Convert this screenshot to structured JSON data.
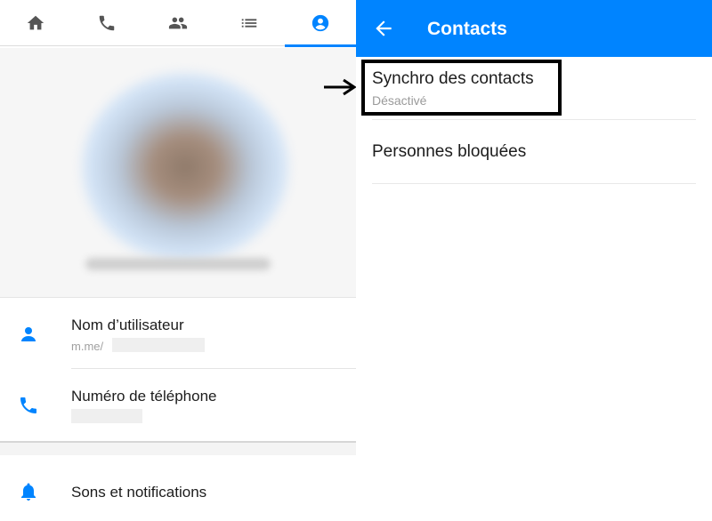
{
  "left_panel": {
    "tabs": [
      {
        "icon": "home-icon"
      },
      {
        "icon": "phone-icon"
      },
      {
        "icon": "people-icon"
      },
      {
        "icon": "list-icon"
      },
      {
        "icon": "account-icon",
        "active": true
      }
    ],
    "rows": {
      "username": {
        "title": "Nom d’utilisateur",
        "prefix": "m.me/"
      },
      "phone": {
        "title": "Numéro de téléphone"
      },
      "notifications": {
        "title": "Sons et notifications"
      }
    }
  },
  "right_panel": {
    "header": {
      "title": "Contacts"
    },
    "settings": {
      "sync": {
        "title": "Synchro des contacts",
        "status": "Désactivé"
      },
      "blocked": {
        "title": "Personnes bloquées"
      }
    }
  },
  "colors": {
    "accent": "#0084ff",
    "tab_icon_inactive": "#555555"
  }
}
